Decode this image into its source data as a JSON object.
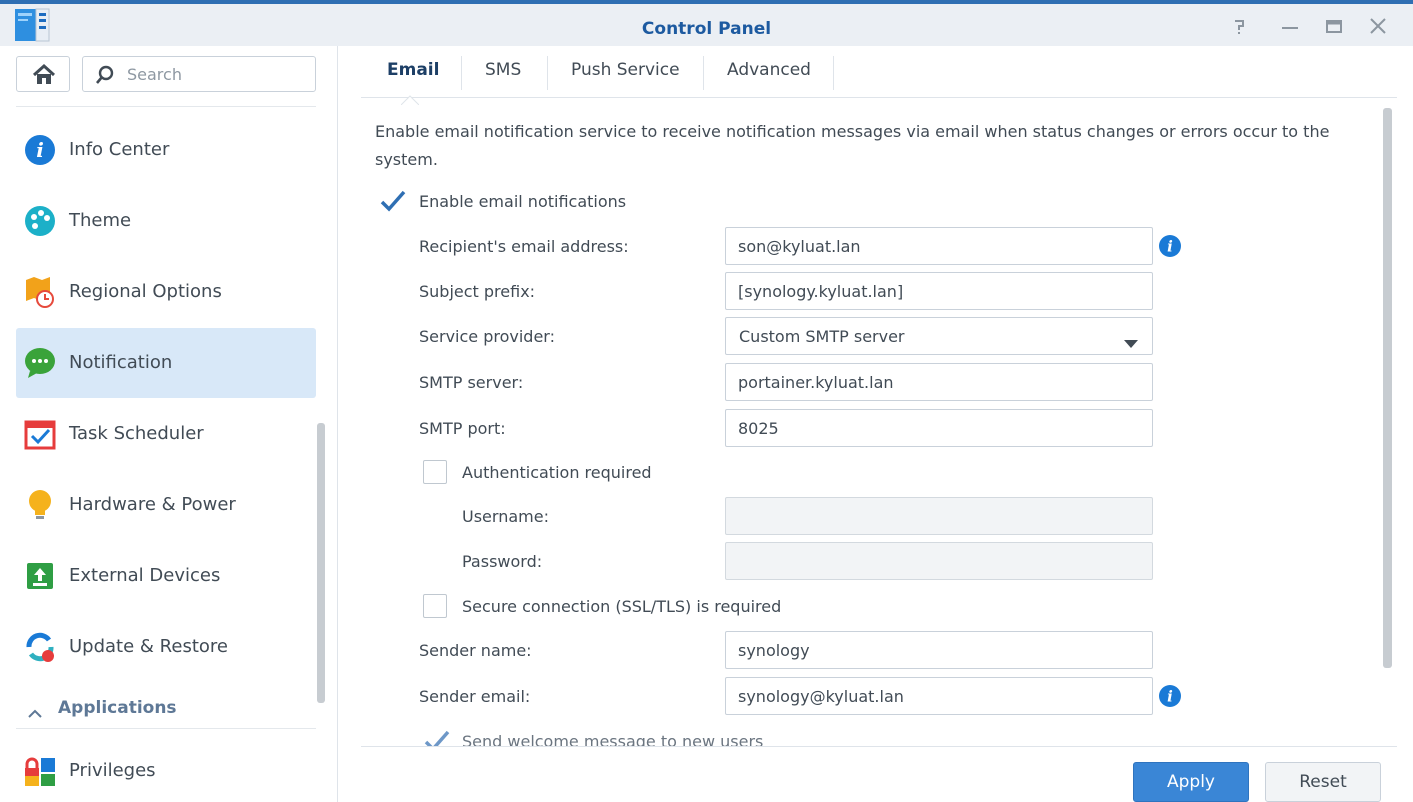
{
  "window": {
    "title": "Control Panel",
    "controls": [
      "help-icon",
      "minimize-icon",
      "maximize-icon",
      "close-icon"
    ]
  },
  "sidebar": {
    "search_placeholder": "Search",
    "items": [
      {
        "label": "Info Center",
        "icon": "info-center-icon"
      },
      {
        "label": "Theme",
        "icon": "theme-palette-icon"
      },
      {
        "label": "Regional Options",
        "icon": "regional-options-icon"
      },
      {
        "label": "Notification",
        "icon": "notification-chat-icon",
        "active": true
      },
      {
        "label": "Task Scheduler",
        "icon": "task-scheduler-icon"
      },
      {
        "label": "Hardware & Power",
        "icon": "lightbulb-icon"
      },
      {
        "label": "External Devices",
        "icon": "external-devices-icon"
      },
      {
        "label": "Update & Restore",
        "icon": "update-restore-icon"
      }
    ],
    "section": {
      "label": "Applications",
      "expanded": true
    },
    "app_items": [
      {
        "label": "Privileges",
        "icon": "privileges-icon"
      }
    ]
  },
  "tabs": [
    {
      "label": "Email",
      "active": true
    },
    {
      "label": "SMS"
    },
    {
      "label": "Push Service"
    },
    {
      "label": "Advanced"
    }
  ],
  "email": {
    "description": "Enable email notification service to receive notification messages via email when status changes or errors occur to the system.",
    "enable_label": "Enable email notifications",
    "enable_checked": true,
    "recipient_label": "Recipient's email address:",
    "recipient_value": "son@kyluat.lan",
    "subject_label": "Subject prefix:",
    "subject_value": "[synology.kyluat.lan]",
    "provider_label": "Service provider:",
    "provider_value": "Custom SMTP server",
    "smtp_server_label": "SMTP server:",
    "smtp_server_value": "portainer.kyluat.lan",
    "smtp_port_label": "SMTP port:",
    "smtp_port_value": "8025",
    "auth_label": "Authentication required",
    "auth_checked": false,
    "username_label": "Username:",
    "username_value": "",
    "password_label": "Password:",
    "password_value": "",
    "ssl_label": "Secure connection (SSL/TLS) is required",
    "ssl_checked": false,
    "sender_name_label": "Sender name:",
    "sender_name_value": "synology",
    "sender_email_label": "Sender email:",
    "sender_email_value": "synology@kyluat.lan",
    "welcome_label": "Send welcome message to new users",
    "welcome_checked": true
  },
  "footer": {
    "apply_label": "Apply",
    "reset_label": "Reset"
  },
  "colors": {
    "accent": "#3a86d6",
    "title": "#1d5aa0",
    "active_nav": "#d8e8f8"
  }
}
